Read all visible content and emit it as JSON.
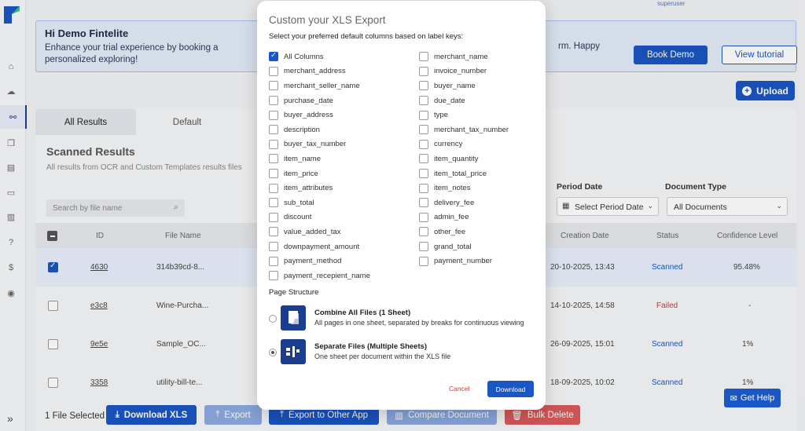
{
  "sidebar": {
    "icons": [
      "home-icon",
      "cloud-upload-icon",
      "scan-icon",
      "documents-icon",
      "templates-icon",
      "presentation-icon",
      "ledger-icon",
      "help-icon",
      "invoice-icon",
      "user-icon"
    ],
    "expand_glyph": "»"
  },
  "header": {
    "user_role": "superuser"
  },
  "banner": {
    "title": "Hi Demo Fintelite",
    "text": "Enhance your trial experience by booking a personalized exploring!",
    "text_tail": "rm. Happy",
    "book_demo": "Book Demo",
    "view_tutorial": "View tutorial"
  },
  "upload_label": "Upload",
  "tabs": [
    "All Results",
    "Default"
  ],
  "results": {
    "title": "Scanned Results",
    "subtitle": "All results from OCR and Custom Templates results files",
    "search_placeholder": "Search by file name",
    "period_label": "Period Date",
    "period_value": "Select Period Date",
    "doctype_label": "Document Type",
    "doctype_value": "All Documents",
    "columns": [
      "ID",
      "File Name",
      "Creation Date",
      "Status",
      "Confidence Level"
    ],
    "rows": [
      {
        "id": "4630",
        "file": "314b39cd-8...",
        "date": "20-10-2025, 13:43",
        "status": "Scanned",
        "confidence": "95.48%",
        "selected": true
      },
      {
        "id": "e3c8",
        "file": "Wine-Purcha...",
        "date": "14-10-2025, 14:58",
        "status": "Failed",
        "confidence": "-",
        "selected": false
      },
      {
        "id": "9e5e",
        "file": "Sample_OC...",
        "date": "26-09-2025, 15:01",
        "status": "Scanned",
        "confidence": "1%",
        "selected": false
      },
      {
        "id": "3358",
        "file": "utility-bill-te...",
        "date": "18-09-2025, 10:02",
        "status": "Scanned",
        "confidence": "1%",
        "selected": false
      }
    ]
  },
  "footer": {
    "selected_text": "1 File Selected",
    "download_xls": "Download XLS",
    "export": "Export",
    "export_other": "Export to Other App",
    "compare": "Compare Document",
    "bulk_delete": "Bulk Delete"
  },
  "get_help": "Get Help",
  "modal": {
    "title": "Custom your XLS Export",
    "subtitle": "Select your preferred default columns based on label keys:",
    "left_columns": [
      {
        "label": "All Columns",
        "checked": true
      },
      {
        "label": "merchant_address",
        "checked": false
      },
      {
        "label": "merchant_seller_name",
        "checked": false
      },
      {
        "label": "purchase_date",
        "checked": false
      },
      {
        "label": "buyer_address",
        "checked": false
      },
      {
        "label": "description",
        "checked": false
      },
      {
        "label": "buyer_tax_number",
        "checked": false
      },
      {
        "label": "item_name",
        "checked": false
      },
      {
        "label": "item_price",
        "checked": false
      },
      {
        "label": "item_attributes",
        "checked": false
      },
      {
        "label": "sub_total",
        "checked": false
      },
      {
        "label": "discount",
        "checked": false
      },
      {
        "label": "value_added_tax",
        "checked": false
      },
      {
        "label": "downpayment_amount",
        "checked": false
      },
      {
        "label": "payment_method",
        "checked": false
      },
      {
        "label": "payment_recepient_name",
        "checked": false
      }
    ],
    "right_columns": [
      {
        "label": "merchant_name",
        "checked": false
      },
      {
        "label": "invoice_number",
        "checked": false
      },
      {
        "label": "buyer_name",
        "checked": false
      },
      {
        "label": "due_date",
        "checked": false
      },
      {
        "label": "type",
        "checked": false
      },
      {
        "label": "merchant_tax_number",
        "checked": false
      },
      {
        "label": "currency",
        "checked": false
      },
      {
        "label": "item_quantity",
        "checked": false
      },
      {
        "label": "item_total_price",
        "checked": false
      },
      {
        "label": "item_notes",
        "checked": false
      },
      {
        "label": "delivery_fee",
        "checked": false
      },
      {
        "label": "admin_fee",
        "checked": false
      },
      {
        "label": "other_fee",
        "checked": false
      },
      {
        "label": "grand_total",
        "checked": false
      },
      {
        "label": "payment_number",
        "checked": false
      }
    ],
    "page_structure_label": "Page Structure",
    "options": [
      {
        "title": "Combine All Files (1 Sheet)",
        "desc": "All pages in one sheet, separated by breaks for continuous viewing",
        "selected": false
      },
      {
        "title": "Separate Files (Multiple Sheets)",
        "desc": "One sheet per document within the XLS file",
        "selected": true
      }
    ],
    "cancel": "Cancel",
    "download": "Download"
  },
  "colors": {
    "primary": "#1a56c4",
    "danger": "#d33333",
    "navy": "#1a3d8f"
  }
}
